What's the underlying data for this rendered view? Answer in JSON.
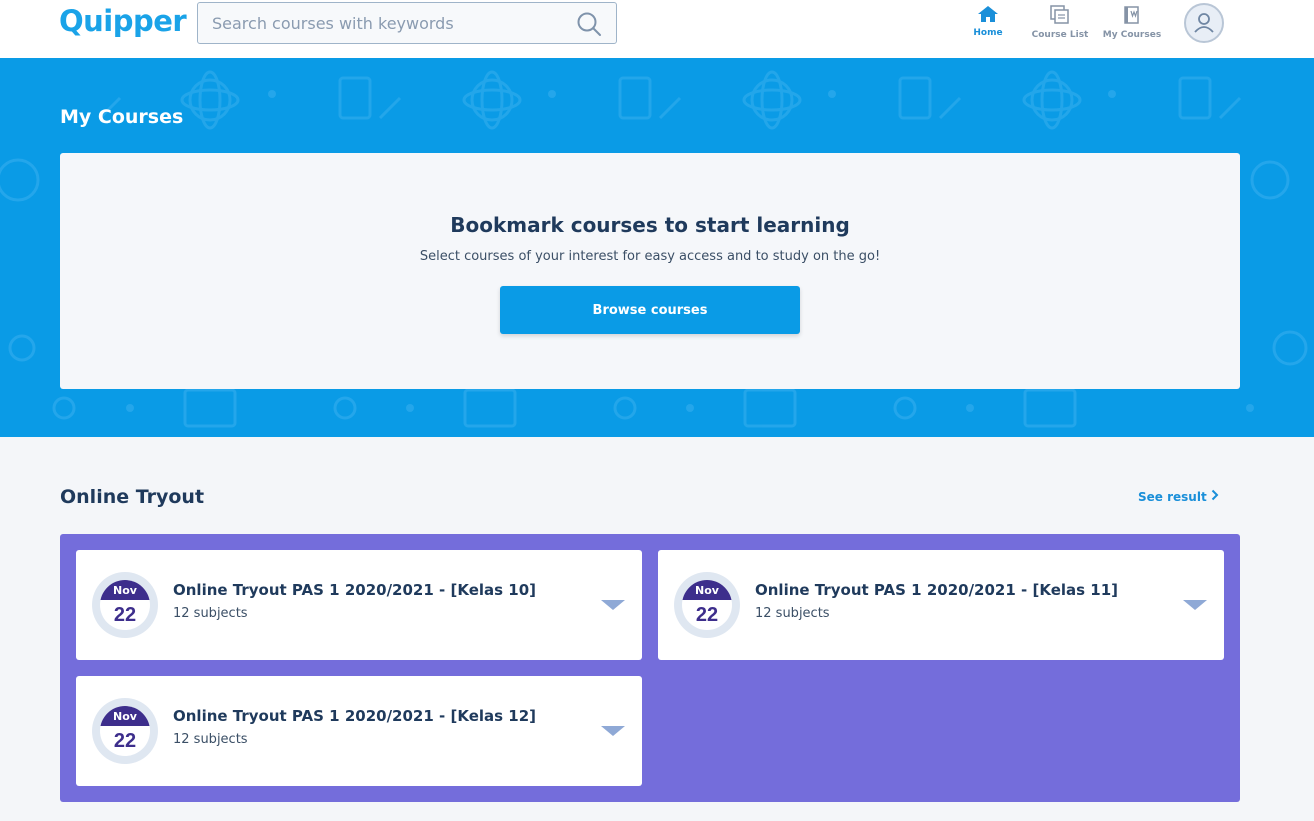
{
  "header": {
    "logo": "Quipper",
    "search_placeholder": "Search courses with keywords",
    "nav": {
      "home": "Home",
      "course_list": "Course List",
      "my_courses": "My Courses"
    }
  },
  "banner": {
    "title": "My Courses",
    "card": {
      "title": "Bookmark courses to start learning",
      "subtitle": "Select courses of your interest for easy access and to study on the go!",
      "button": "Browse courses"
    }
  },
  "tryout": {
    "title": "Online Tryout",
    "see_result": "See result",
    "items": [
      {
        "month": "Nov",
        "day": "22",
        "title": "Online Tryout PAS 1 2020/2021 - [Kelas 10]",
        "subtitle": "12 subjects"
      },
      {
        "month": "Nov",
        "day": "22",
        "title": "Online Tryout PAS 1 2020/2021 - [Kelas 11]",
        "subtitle": "12 subjects"
      },
      {
        "month": "Nov",
        "day": "22",
        "title": "Online Tryout PAS 1 2020/2021 - [Kelas 12]",
        "subtitle": "12 subjects"
      }
    ]
  },
  "colors": {
    "brand_blue": "#0a9be6",
    "tryout_purple": "#746ddb",
    "date_purple": "#3d2e8c"
  }
}
